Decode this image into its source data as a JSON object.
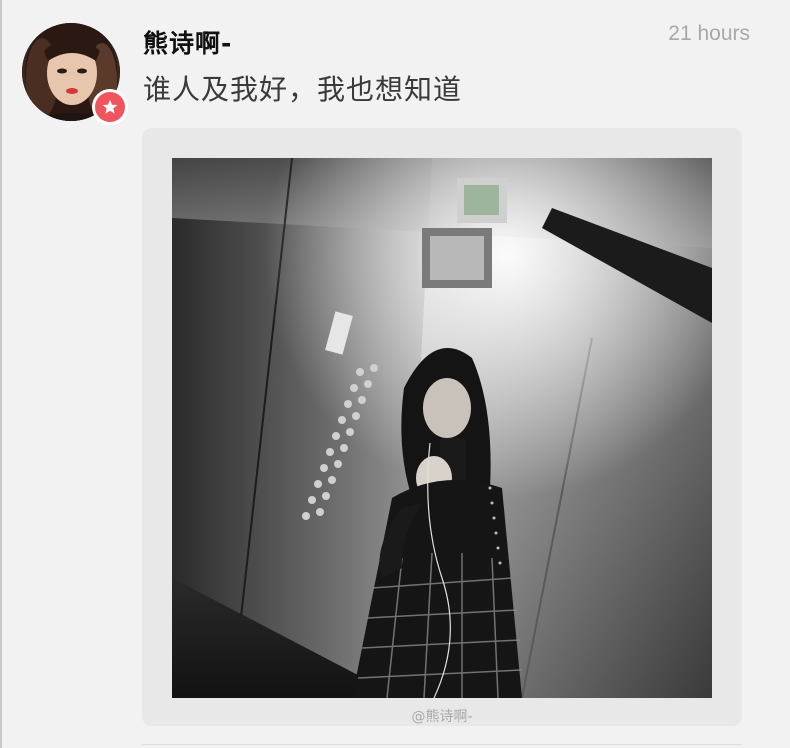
{
  "post": {
    "author": {
      "name": "熊诗啊-",
      "avatar_icon": "user-avatar",
      "badge_icon": "star-icon",
      "badge_color": "#f0555f"
    },
    "timestamp": "21 hours",
    "text": "谁人及我好，我也想知道",
    "media": {
      "type": "photo",
      "watermark": "@熊诗啊-"
    }
  },
  "colors": {
    "background": "#f2f2f2",
    "card": "#e8e8e8",
    "meta_text": "#a8a8a8"
  }
}
